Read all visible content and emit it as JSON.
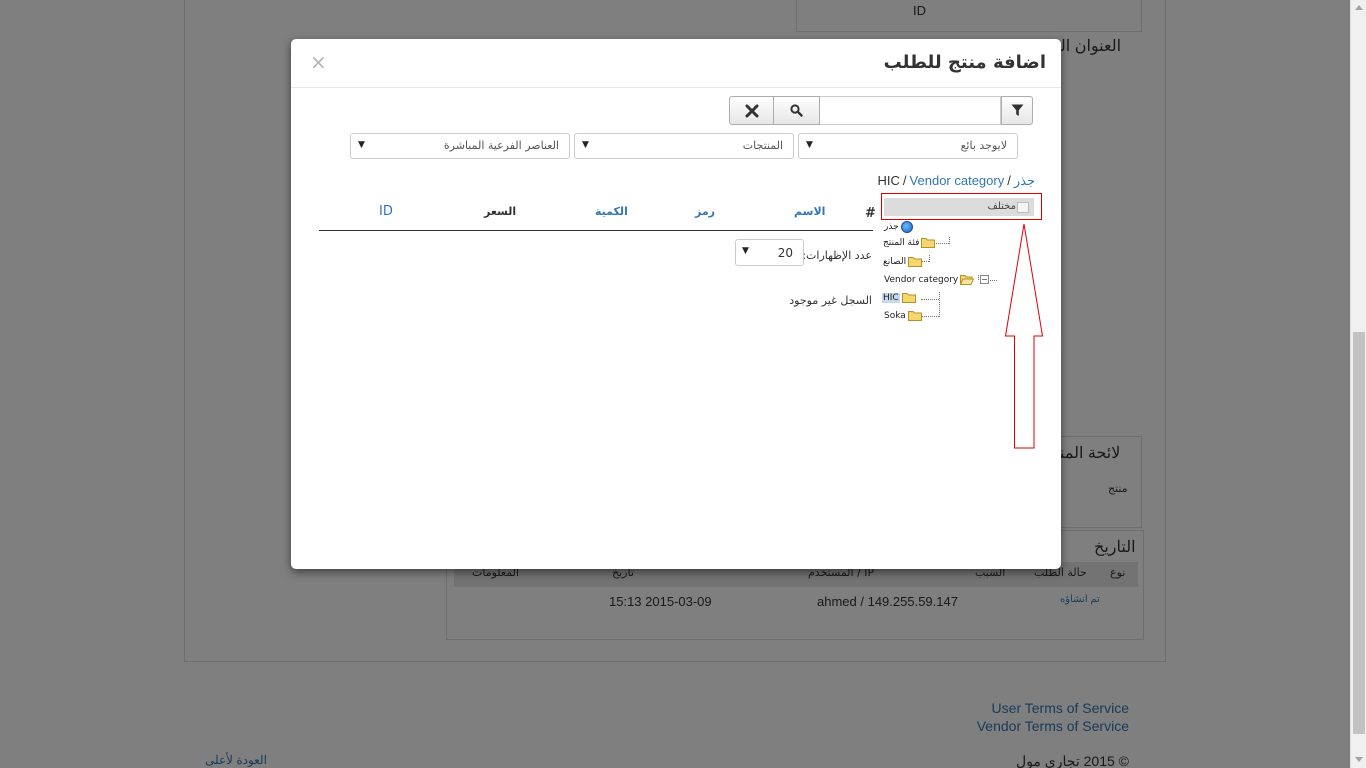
{
  "background": {
    "id_label": "ID",
    "heading_address": "العنوان الذي",
    "heading_products": "لائحة المنتجا",
    "product_label": "منتج",
    "heading_history": "التاريخ",
    "history_table": {
      "headers": [
        "نوع",
        "حالة الطلب",
        "السبب",
        "المستخدم / IP",
        "تاريخ",
        "المعلومات"
      ],
      "row": {
        "type": "تم انشاؤه",
        "user_ip": "ahmed / 149.255.59.147",
        "date": "15:13 2015-03-09"
      }
    },
    "footer": {
      "user_terms": "User Terms of Service",
      "vendor_terms": "Vendor Terms of Service",
      "copyright": "© 2015 تجاري مول",
      "back_to_top": "العودة لأعلى"
    }
  },
  "modal": {
    "title": "اضافة منتج للطلب",
    "close": "×",
    "search": {
      "placeholder": "",
      "clear_icon": "times-icon",
      "search_icon": "search-icon",
      "filter_icon": "filter-icon"
    },
    "selects": {
      "vendor": "لايوجد بائع",
      "products": "المنتجات",
      "children": "العناصر الفرعية المباشرة"
    },
    "breadcrumb": {
      "root": "جذر",
      "sep": "/",
      "hic": "HIC",
      "vendor_category": "Vendor category"
    },
    "tree": {
      "selected": "مختلف",
      "nodes": {
        "root": "جذر",
        "product_category": "فئة المنتج",
        "manufacturer": "الصانع",
        "vendor_category": "Vendor category",
        "hic": "HIC",
        "soka": "Soka"
      }
    },
    "table": {
      "headers": {
        "hash": "#",
        "name": "الاسم",
        "code": "رمز",
        "quantity": "الكمية",
        "price": "السعر",
        "id": "ID"
      }
    },
    "per_page": {
      "label": "عدد الإظهارات:",
      "value": "20"
    },
    "no_record": "السجل غير موجود"
  },
  "colors": {
    "link": "#3277b3",
    "annotation": "#e00000",
    "backdrop": "rgba(0,0,0,0.5)"
  }
}
